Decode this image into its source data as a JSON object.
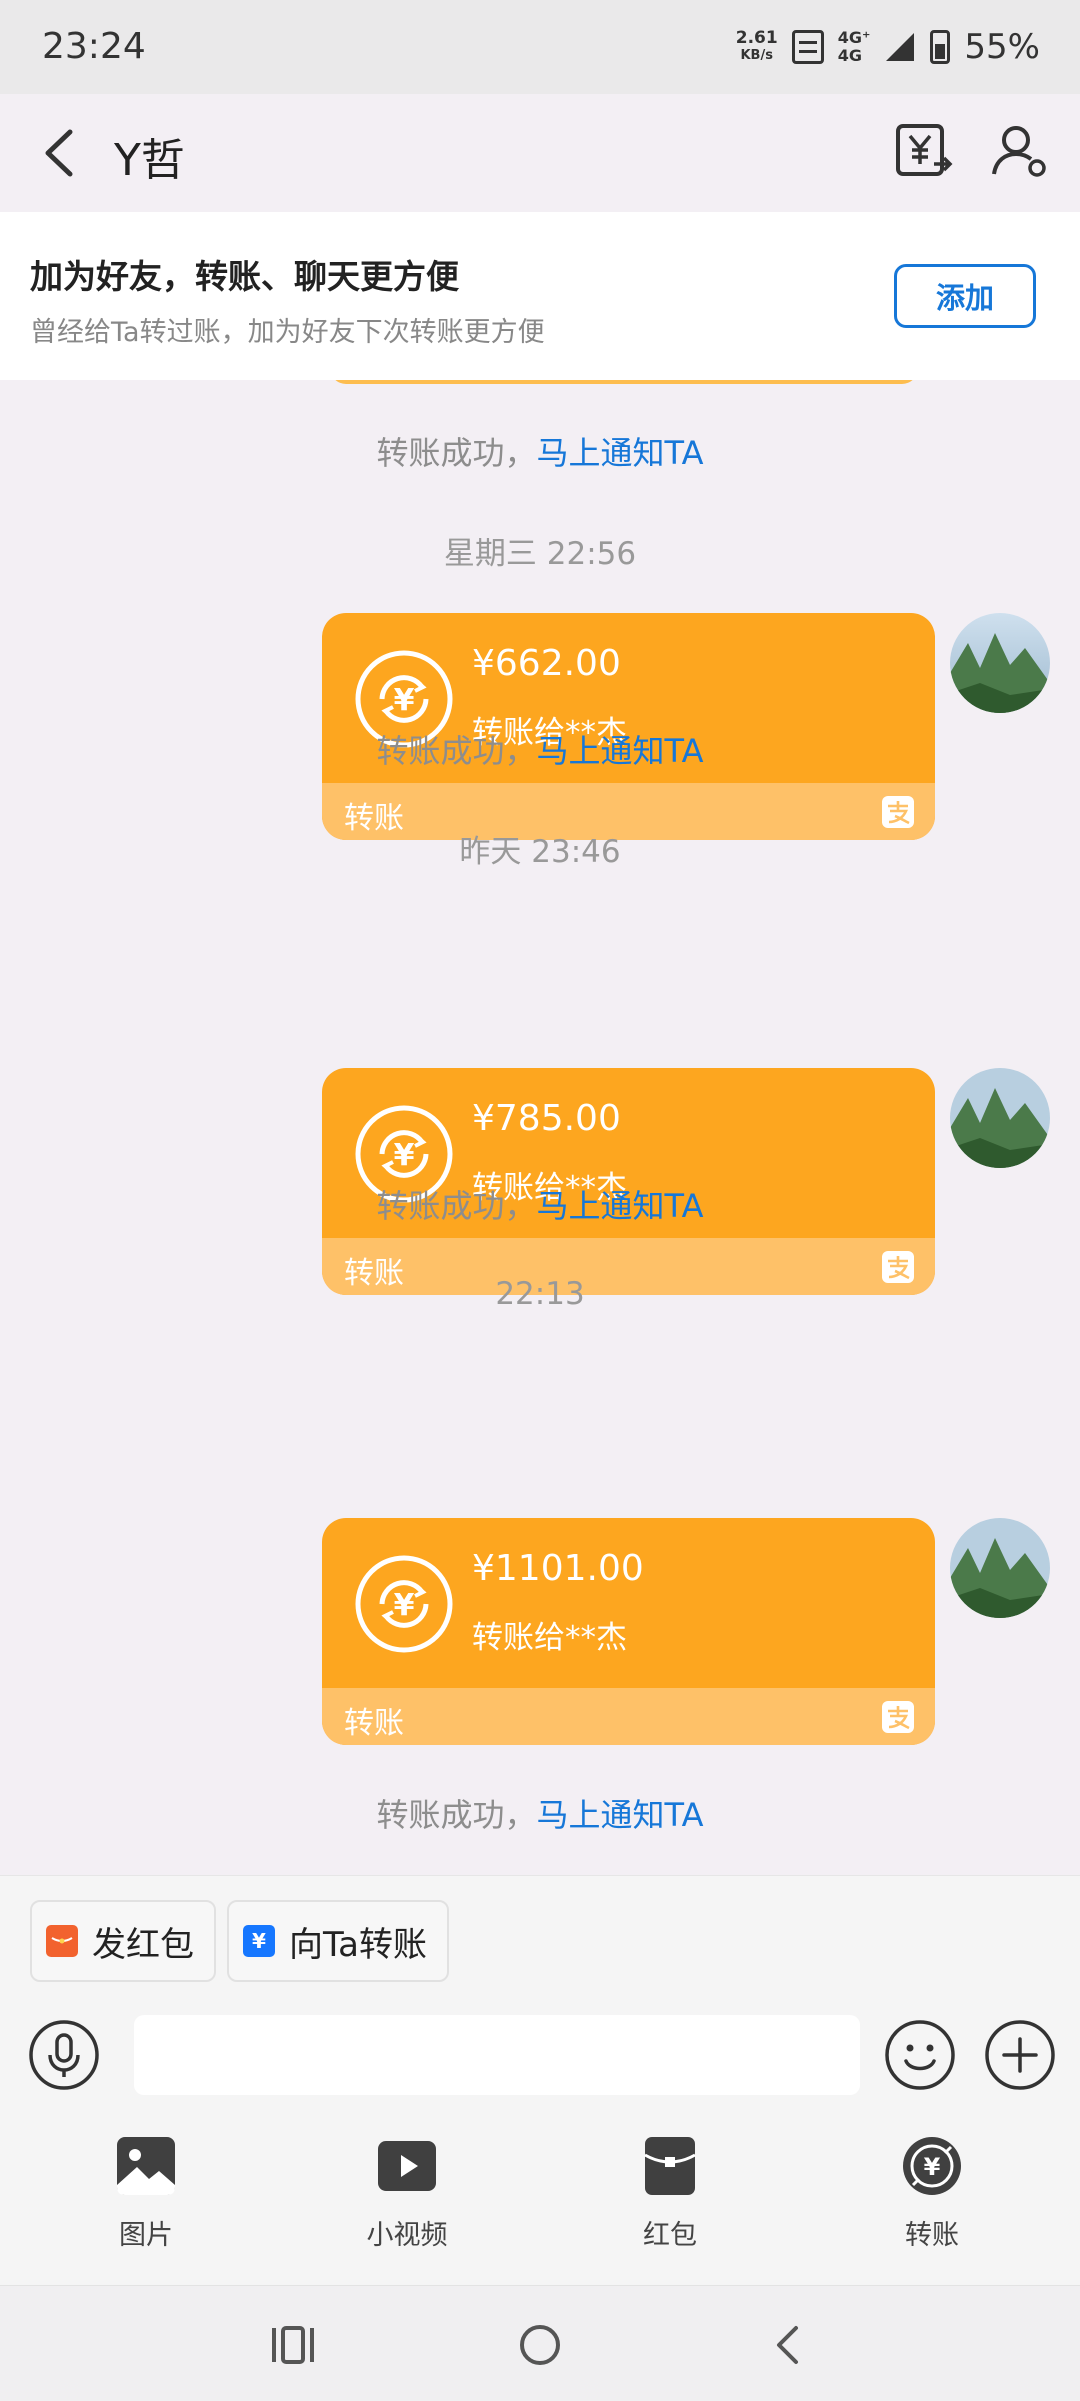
{
  "status_bar": {
    "time": "23:24",
    "speed_value": "2.61",
    "speed_unit": "KB/s",
    "net_top": "4G⁺",
    "net_bottom": "4G",
    "battery": "55%"
  },
  "header": {
    "title": "Y哲"
  },
  "banner": {
    "title": "加为好友，转账、聊天更方便",
    "subtitle": "曾经给Ta转过账，加为好友下次转账更方便",
    "add_label": "添加"
  },
  "messages": {
    "notice_prefix": "转账成功，",
    "notice_link": "马上通知TA",
    "card_label": "转账",
    "recipient": "转账给**杰",
    "times": [
      "星期三 22:56",
      "昨天 23:46",
      "22:13"
    ],
    "amounts": [
      "¥662.00",
      "¥785.00",
      "¥1101.00"
    ]
  },
  "quick_actions": {
    "red_packet": "发红包",
    "transfer": "向Ta转账"
  },
  "input": {
    "placeholder": ""
  },
  "panel": {
    "photo": "图片",
    "video": "小视频",
    "red_packet": "红包",
    "transfer": "转账"
  },
  "colors": {
    "card": "#fda61f",
    "card_footer": "#fec168",
    "link": "#1677d8",
    "background": "#f3eff4"
  }
}
